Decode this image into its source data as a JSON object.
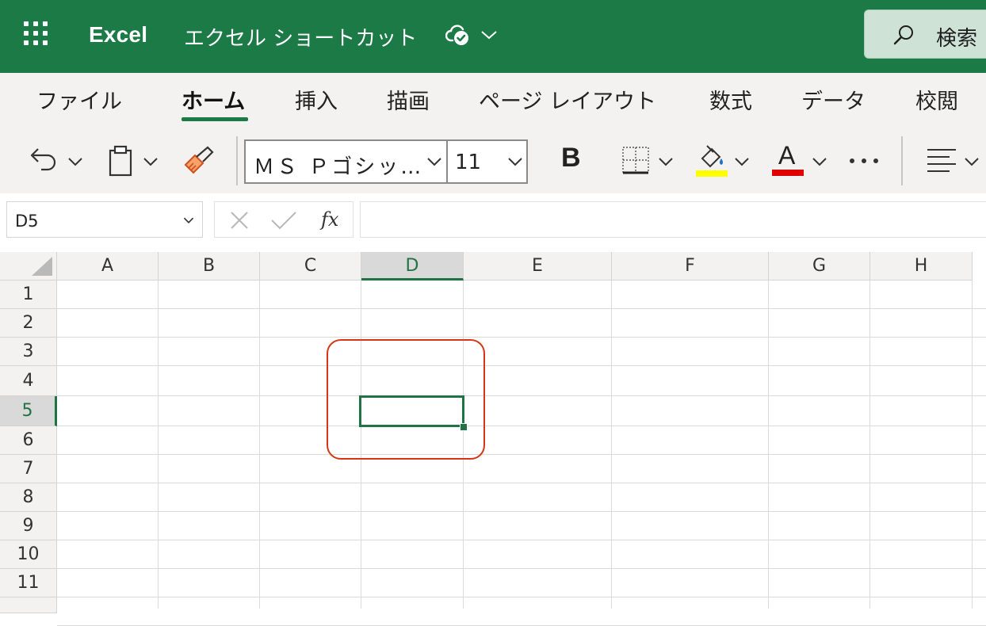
{
  "titlebar": {
    "app_name": "Excel",
    "document_title": "エクセル ショートカット",
    "search_label": "検索",
    "background": "#1b7a46"
  },
  "ribbon": {
    "tabs": [
      "ファイル",
      "ホーム",
      "挿入",
      "描画",
      "ページ レイアウト",
      "数式",
      "データ",
      "校閲"
    ],
    "active_tab": "ホーム"
  },
  "toolbar": {
    "font_name": "ＭＳ Ｐゴシッ…",
    "font_size": "11",
    "bold_label": "B",
    "font_color_label": "A",
    "highlight_color": "#ffff00",
    "font_color": "#e00000"
  },
  "formula_bar": {
    "name_box": "D5",
    "fx_label": "fx",
    "formula_value": ""
  },
  "grid": {
    "columns": [
      "A",
      "B",
      "C",
      "D",
      "E",
      "F",
      "G",
      "H"
    ],
    "rows": [
      "1",
      "2",
      "3",
      "4",
      "5",
      "6",
      "7",
      "8",
      "9",
      "10",
      "11"
    ],
    "selected_column": "D",
    "selected_row": "5",
    "active_cell": "D5",
    "accent": "#217346",
    "highlight_color": "#d93418"
  }
}
